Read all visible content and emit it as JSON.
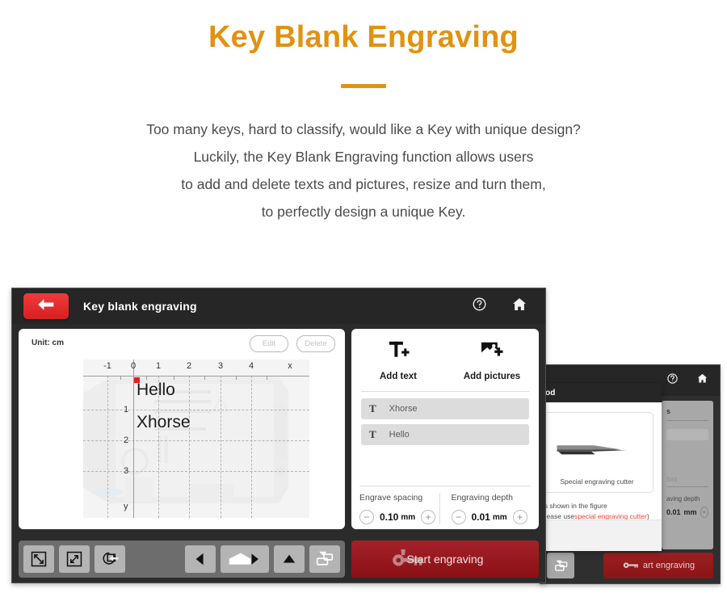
{
  "hero": {
    "title": "Key Blank Engraving",
    "lines": [
      "Too many keys, hard to classify, would like a Key with unique design?",
      "Luckily, the Key Blank Engraving function allows users",
      "to add and delete texts and pictures, resize and turn them,",
      "to perfectly design a unique Key."
    ],
    "accent_color": "#e29211",
    "body_color": "#4b4b4b"
  },
  "screenshot_main": {
    "header": {
      "back_icon": "arrow-left-icon",
      "title": "Key blank engraving",
      "help_icon": "help-circle-icon",
      "home_icon": "home-icon"
    },
    "canvas": {
      "unit_label": "Unit: cm",
      "edit_label": "Edit",
      "delete_label": "Delete",
      "x_axis_label": "x",
      "y_axis_label": "y",
      "x_ticks": [
        "-1",
        "0",
        "1",
        "2",
        "3",
        "4"
      ],
      "y_ticks": [
        "1",
        "2",
        "3"
      ],
      "texts": [
        "Hello",
        "Xhorse"
      ],
      "marker_color": "#ef1d1d"
    },
    "tools": {
      "add_text_label": "Add text",
      "add_text_icon": "add-text-icon",
      "add_pictures_label": "Add pictures",
      "add_pictures_icon": "add-picture-icon",
      "layers": [
        {
          "icon": "text-layer-icon",
          "label": "Xhorse"
        },
        {
          "icon": "text-layer-icon",
          "label": "Hello"
        }
      ]
    },
    "params": {
      "spacing_title": "Engrave spacing",
      "spacing_value": "0.10",
      "spacing_unit": "mm",
      "depth_title": "Engraving depth",
      "depth_value": "0.01",
      "depth_unit": "mm",
      "minus_glyph": "−",
      "plus_glyph": "+"
    },
    "toolbar": [
      {
        "name": "shrink-button",
        "icon": "shrink-arrows-icon"
      },
      {
        "name": "enlarge-button",
        "icon": "enlarge-arrows-icon"
      },
      {
        "name": "rotate-button",
        "icon": "rotate-left-icon"
      },
      {
        "name": "move-left-button",
        "icon": "triangle-left-icon"
      },
      {
        "name": "move-pan-button",
        "icon": "pan-right-icon"
      },
      {
        "name": "move-up-button",
        "icon": "triangle-up-icon"
      },
      {
        "name": "layer-order-button",
        "icon": "bring-forward-icon"
      }
    ],
    "start_button": {
      "label": "Start engraving",
      "icon": "key-cutter-icon",
      "color": "#9b1f21"
    }
  },
  "screenshot_secondary": {
    "header": {
      "help_icon": "help-circle-icon",
      "home_icon": "home-icon"
    },
    "dialog": {
      "title_fragment": "hod",
      "cutter_caption": "Special engraving cutter",
      "note_line_1": "as shown in the figure",
      "note_line_2_prefix": "Please use",
      "note_line_2_accent": "special engraving cutter",
      "note_line_2_suffix": ")",
      "accent_color": "#ef4136"
    },
    "panel": {
      "title_fragment": "s",
      "faint_fragment": "font",
      "depth_title_fragment": "aving depth",
      "depth_value": "0.01",
      "depth_unit": "mm",
      "minus_glyph": "−",
      "plus_glyph": "+"
    },
    "start_button": {
      "label": "art engraving"
    },
    "toolbar_icon": "bring-forward-icon"
  }
}
